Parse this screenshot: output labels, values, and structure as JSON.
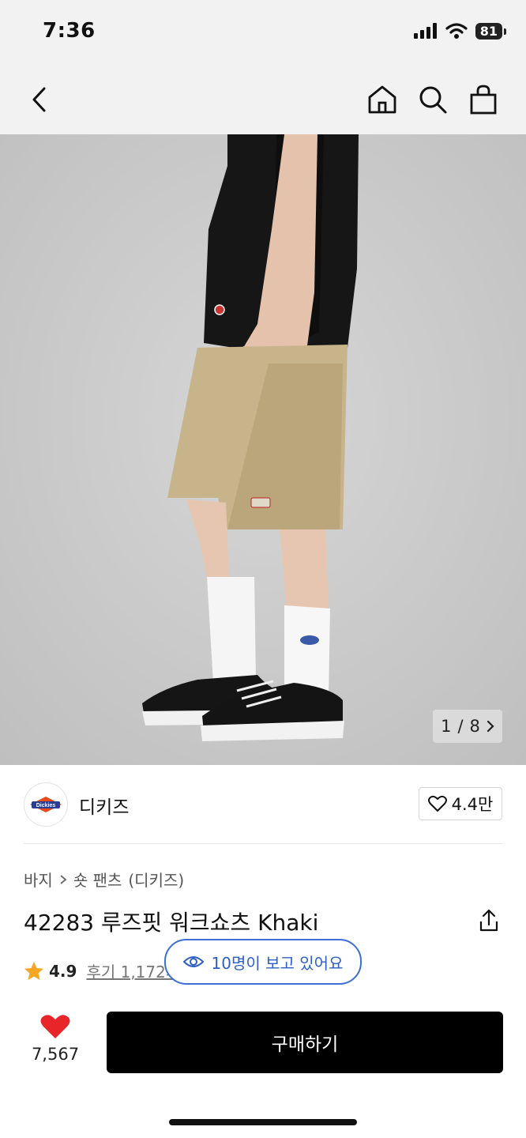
{
  "status": {
    "time": "7:36",
    "battery": "81"
  },
  "nav": {
    "back": "back",
    "home": "home",
    "search": "search",
    "cart": "cart"
  },
  "image": {
    "page_current": "1",
    "page_sep": "/",
    "page_total": "8"
  },
  "brand": {
    "name": "디키즈",
    "logo_text": "Dickies",
    "likes": "4.4만"
  },
  "breadcrumb": {
    "category": "바지",
    "subcategory": "숏 팬츠",
    "brand": "(디키즈)"
  },
  "product": {
    "title": "42283 루즈핏 워크쇼츠 Khaki"
  },
  "rating": {
    "value": "4.9",
    "reviews": "후기 1,172개"
  },
  "viewers": {
    "text": "10명이 보고 있어요"
  },
  "bottom": {
    "wish_count": "7,567",
    "buy_label": "구매하기"
  },
  "colors": {
    "accent_blue": "#3b6fd6",
    "heart_red": "#e8262a",
    "star_orange": "#f5a623",
    "buy_bg": "#000000"
  }
}
